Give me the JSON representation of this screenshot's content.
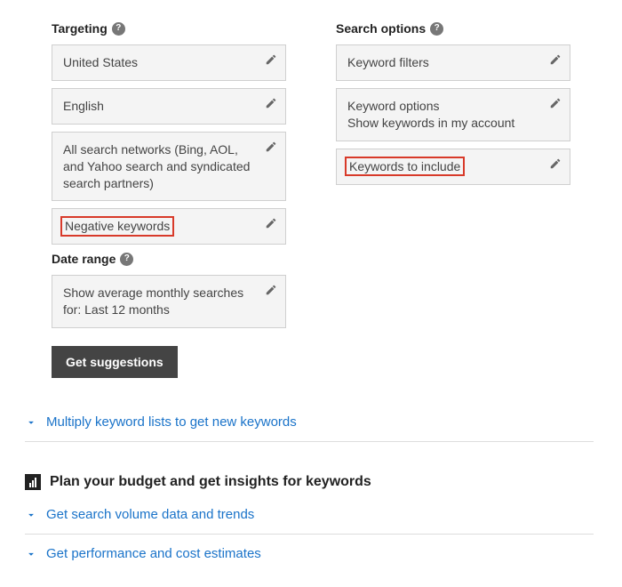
{
  "targeting": {
    "heading": "Targeting",
    "location": "United States",
    "language": "English",
    "network": "All search networks (Bing, AOL, and Yahoo search and syndicated search partners)",
    "negative_keywords": "Negative keywords"
  },
  "date_range": {
    "heading": "Date range",
    "value": "Show average monthly searches for: Last 12 months"
  },
  "get_suggestions_label": "Get suggestions",
  "search_options": {
    "heading": "Search options",
    "keyword_filters": "Keyword filters",
    "keyword_options_line1": "Keyword options",
    "keyword_options_line2": "Show keywords in my account",
    "keywords_include": "Keywords to include"
  },
  "accordion": {
    "multiply": "Multiply keyword lists to get new keywords",
    "budget_heading": "Plan your budget and get insights for keywords",
    "search_volume": "Get search volume data and trends",
    "performance": "Get performance and cost estimates"
  }
}
